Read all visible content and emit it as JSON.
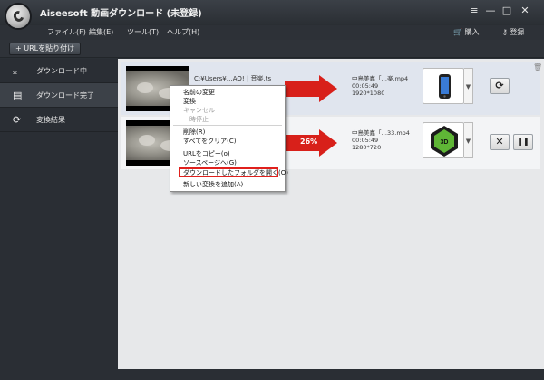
{
  "window": {
    "title": "Aiseesoft 動画ダウンロード (未登録)",
    "controls": {
      "menu": "≡",
      "minimize": "—",
      "maximize": "□",
      "close": "✕"
    }
  },
  "menu": {
    "items": [
      "ファイル(F)",
      "編集(E)",
      "ツール(T)",
      "ヘルプ(H)"
    ],
    "purchase": "購入",
    "register": "登録"
  },
  "toolbar": {
    "paste_url": "+ URLを貼り付け"
  },
  "sidebar": {
    "items": [
      {
        "label": "ダウンロード中",
        "icon": "download-icon",
        "glyph": "⤓",
        "active": false
      },
      {
        "label": "ダウンロード完了",
        "icon": "completed-icon",
        "glyph": "▤",
        "active": true
      },
      {
        "label": "変換結果",
        "icon": "convert-icon",
        "glyph": "⟳",
        "active": false
      }
    ]
  },
  "tasks": [
    {
      "path": "C:¥Users¥…AO! | 音楽.ts",
      "output_name": "中島美嘉「…楽.mp4",
      "duration": "00:05:49",
      "resolution": "1920*1080",
      "progress_text": "",
      "device": "iphone-icon",
      "action_glyph": "⟳"
    },
    {
      "path": "",
      "output_name": "中島美嘉「…33.mp4",
      "duration": "00:05:49",
      "resolution": "1280*720",
      "progress_text": "26%",
      "device": "mp4-3d-icon",
      "action_glyph": "✕",
      "pause_glyph": "❚❚"
    }
  ],
  "context_menu": {
    "items": [
      {
        "label": "名前の変更",
        "disabled": false
      },
      {
        "label": "変換",
        "disabled": false
      },
      {
        "label": "キャンセル",
        "disabled": true
      },
      {
        "label": "一時停止",
        "disabled": true
      },
      {
        "label": "削除(R)",
        "disabled": false
      },
      {
        "label": "すべてをクリア(C)",
        "disabled": false
      },
      {
        "label": "URLをコピー(o)",
        "disabled": false
      },
      {
        "label": "ソースページへ(G)",
        "disabled": false
      },
      {
        "label": "ダウンロードしたフォルダを開く(O)",
        "disabled": false,
        "highlighted": true
      },
      {
        "label": "新しい変換を追加(A)",
        "disabled": false
      }
    ]
  },
  "colors": {
    "accent_red": "#d8201a",
    "highlight_box": "#e0201c",
    "sidebar_bg": "#2a2e34",
    "content_bg": "#e7e8ea"
  }
}
